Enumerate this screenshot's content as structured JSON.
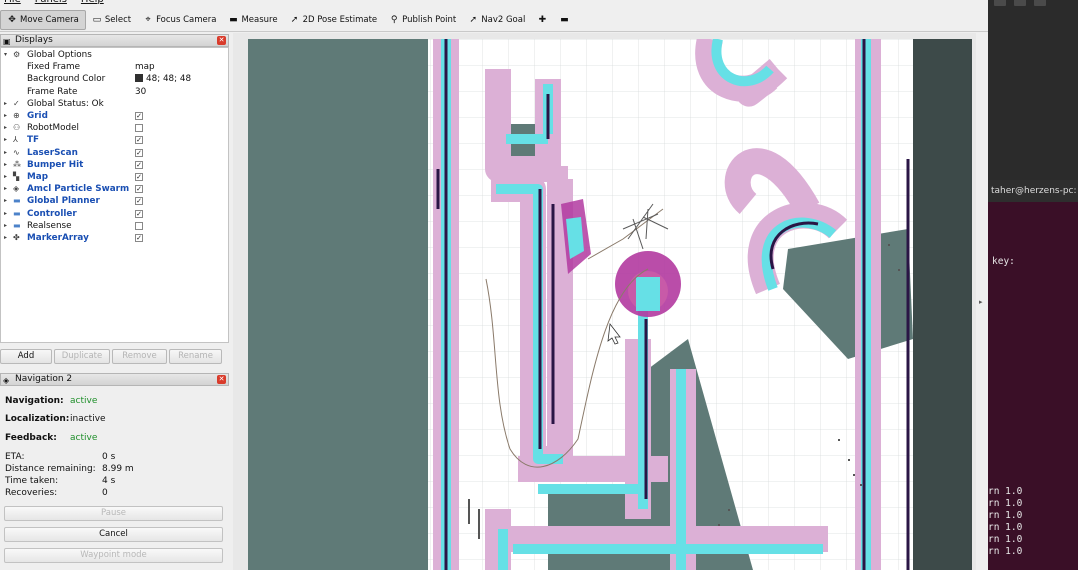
{
  "menu": [
    "File",
    "Panels",
    "Help"
  ],
  "toolbar": [
    {
      "label": "Move Camera",
      "icon": "move-camera-icon",
      "glyph": "✥",
      "active": true
    },
    {
      "label": "Select",
      "icon": "select-icon",
      "glyph": "▭",
      "active": false
    },
    {
      "label": "Focus Camera",
      "icon": "focus-camera-icon",
      "glyph": "⌖",
      "active": false
    },
    {
      "label": "Measure",
      "icon": "measure-icon",
      "glyph": "▬",
      "active": false
    },
    {
      "label": "2D Pose Estimate",
      "icon": "pose-estimate-icon",
      "glyph": "➚",
      "active": false
    },
    {
      "label": "Publish Point",
      "icon": "publish-point-icon",
      "glyph": "⚲",
      "active": false
    },
    {
      "label": "Nav2 Goal",
      "icon": "nav2-goal-icon",
      "glyph": "➚",
      "active": false
    },
    {
      "label": "",
      "icon": "add-tool-icon",
      "glyph": "✚",
      "active": false
    },
    {
      "label": "",
      "icon": "remove-tool-icon",
      "glyph": "▬",
      "active": false
    }
  ],
  "displays": {
    "title": "Displays",
    "rows": [
      {
        "label": "Global Options",
        "icon": "gear-icon",
        "glyph": "⚙",
        "level": 0,
        "expanded": true
      },
      {
        "label": "Fixed Frame",
        "value": "map",
        "level": 1
      },
      {
        "label": "Background Color",
        "value": "48; 48; 48",
        "swatch": "#303030",
        "level": 1
      },
      {
        "label": "Frame Rate",
        "value": "30",
        "level": 1
      },
      {
        "label": "Global Status: Ok",
        "icon": "checkmark-icon",
        "glyph": "✓",
        "level": 0
      },
      {
        "label": "Grid",
        "icon": "grid-icon",
        "glyph": "⊕",
        "level": 0,
        "checked": true,
        "blue": true
      },
      {
        "label": "RobotModel",
        "icon": "robot-model-icon",
        "glyph": "⚇",
        "level": 0,
        "checked": false,
        "blue": false
      },
      {
        "label": "TF",
        "icon": "tf-icon",
        "glyph": "⅄",
        "level": 0,
        "checked": true,
        "blue": true
      },
      {
        "label": "LaserScan",
        "icon": "laser-scan-icon",
        "glyph": "∿",
        "level": 0,
        "checked": true,
        "blue": true
      },
      {
        "label": "Bumper Hit",
        "icon": "bumper-hit-icon",
        "glyph": "⁂",
        "level": 0,
        "checked": true,
        "blue": true
      },
      {
        "label": "Map",
        "icon": "map-icon",
        "glyph": "▚",
        "level": 0,
        "checked": true,
        "blue": true
      },
      {
        "label": "Amcl Particle Swarm",
        "icon": "particle-swarm-icon",
        "glyph": "◈",
        "level": 0,
        "checked": true,
        "blue": true
      },
      {
        "label": "Global Planner",
        "icon": "folder-icon",
        "glyph": "▬",
        "level": 0,
        "checked": true,
        "blue": true
      },
      {
        "label": "Controller",
        "icon": "folder-icon",
        "glyph": "▬",
        "level": 0,
        "checked": true,
        "blue": true
      },
      {
        "label": "Realsense",
        "icon": "folder-icon",
        "glyph": "▬",
        "level": 0,
        "checked": false,
        "blue": false
      },
      {
        "label": "MarkerArray",
        "icon": "marker-array-icon",
        "glyph": "✤",
        "level": 0,
        "checked": true,
        "blue": true
      }
    ],
    "buttons": {
      "add": "Add",
      "duplicate": "Duplicate",
      "remove": "Remove",
      "rename": "Rename"
    }
  },
  "navigation": {
    "title": "Navigation 2",
    "navigation_label": "Navigation:",
    "navigation_value": "active",
    "localization_label": "Localization:",
    "localization_value": "inactive",
    "feedback_label": "Feedback:",
    "feedback_value": "active",
    "eta_label": "ETA:",
    "eta_value": "0 s",
    "distance_label": "Distance remaining:",
    "distance_value": "8.99 m",
    "time_label": "Time taken:",
    "time_value": "4 s",
    "recoveries_label": "Recoveries:",
    "recoveries_value": "0",
    "pause_label": "Pause",
    "cancel_label": "Cancel",
    "waypoint_label": "Waypoint mode"
  },
  "terminal": {
    "title": "taher@herzens-pc:",
    "lines": [
      "key:",
      "rn 1.0",
      "rn 1.0",
      "rn 1.0",
      "rn 1.0",
      "rn 1.0",
      "rn 1.0"
    ]
  },
  "colors": {
    "map_free": "#ffffff",
    "map_occupied": "#5f7a77",
    "inflation_pink": "#dcb0d6",
    "inflation_cyan": "#66e0e6",
    "wall_dark": "#2a1545",
    "robot_magenta": "#b23aa0",
    "status_green": "#1f8f2a"
  }
}
